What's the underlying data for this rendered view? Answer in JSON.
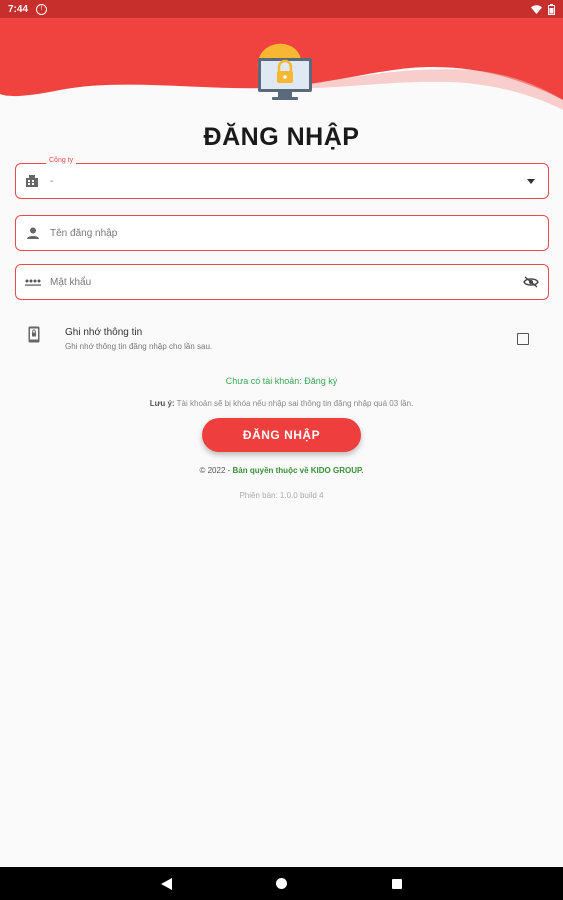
{
  "status_bar": {
    "time": "7:44"
  },
  "page": {
    "title": "ĐĂNG NHẬP"
  },
  "company": {
    "label": "Công ty",
    "value": "-"
  },
  "username": {
    "placeholder": "Tên đăng nhập"
  },
  "password": {
    "placeholder": "Mật khẩu"
  },
  "remember": {
    "title": "Ghi nhớ thông tin",
    "subtitle": "Ghi nhớ thông tin đăng nhập cho lần sau.",
    "checked": false
  },
  "register": {
    "text": "Chưa có tài khoản: Đăng ký"
  },
  "note": {
    "label": "Lưu ý:",
    "text": "Tài khoản sẽ bị khóa nếu nhập sai thông tin đăng nhập quá 03 lần."
  },
  "login_button": {
    "label": "ĐĂNG NHẬP"
  },
  "footer": {
    "copyright_prefix": "© 2022 - ",
    "copyright_brand": "Bản quyền thuộc về KIDO GROUP.",
    "version": "Phiên bản: 1.0.0 build 4"
  },
  "colors": {
    "accent": "#ee3e3e",
    "header": "#f0433f",
    "status": "#c62f2c",
    "link": "#3aa655"
  }
}
